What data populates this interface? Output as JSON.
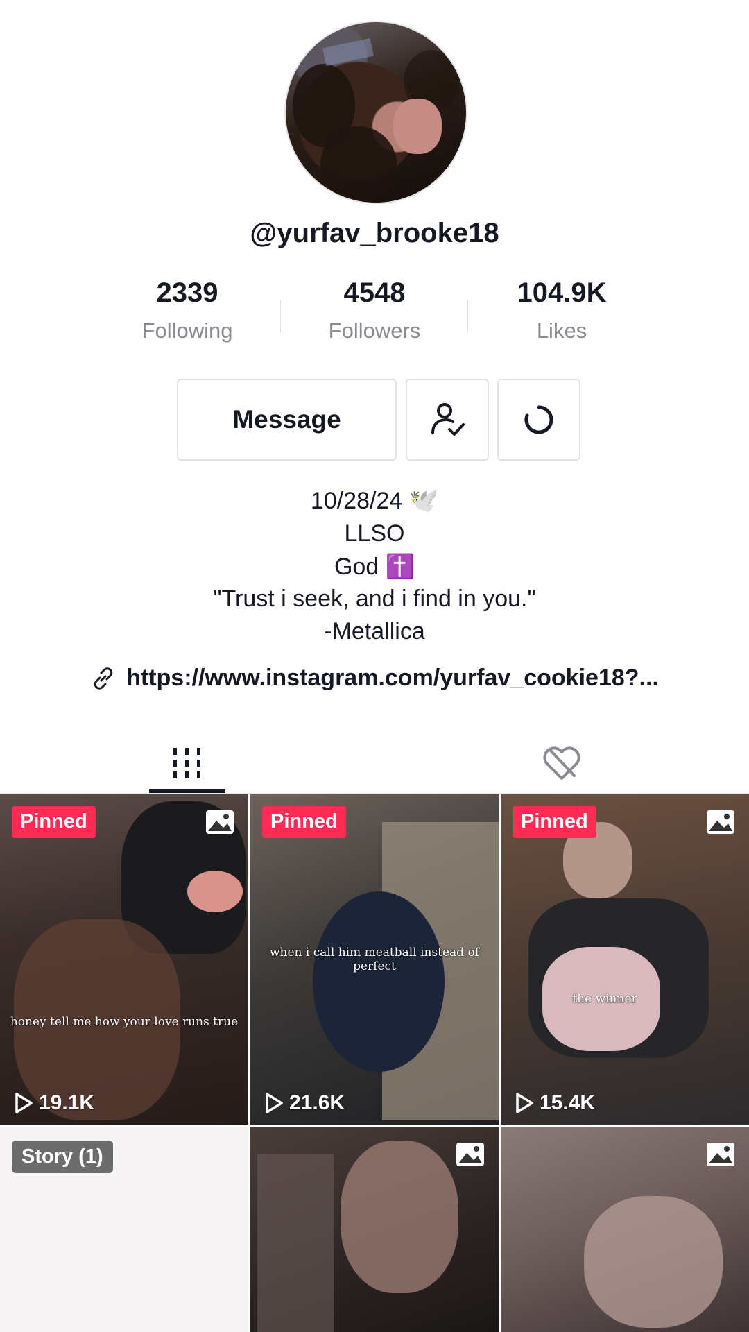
{
  "profile": {
    "username": "@yurfav_brooke18",
    "stats": [
      {
        "value": "2339",
        "label": "Following"
      },
      {
        "value": "4548",
        "label": "Followers"
      },
      {
        "value": "104.9K",
        "label": "Likes"
      }
    ],
    "message_label": "Message",
    "bio_lines": [
      "10/28/24 🕊️",
      "LLSO",
      "God ✝️",
      "\"Trust i seek, and i find in you.\"",
      "-Metallica"
    ],
    "link": "https://www.instagram.com/yurfav_cookie18?..."
  },
  "tabs": [
    {
      "name": "videos",
      "icon": "grid-icon",
      "active": true
    },
    {
      "name": "liked",
      "icon": "hidden-heart-icon",
      "active": false
    }
  ],
  "videos": [
    {
      "badge": "Pinned",
      "views": "19.1K",
      "caption": "honey tell me how your love runs true",
      "icon": "photo-icon"
    },
    {
      "badge": "Pinned",
      "views": "21.6K",
      "caption": "when i call him meatball instead of perfect",
      "icon": "photo-icon"
    },
    {
      "badge": "Pinned",
      "views": "15.4K",
      "caption": "the winner",
      "icon": "photo-icon"
    },
    {
      "badge": "Story (1)"
    },
    {
      "icon": "photo-icon"
    },
    {
      "icon": "photo-icon"
    }
  ],
  "colors": {
    "pinned_badge": "#fe2c55",
    "text_primary": "#161823",
    "text_secondary": "#8a8b91"
  }
}
